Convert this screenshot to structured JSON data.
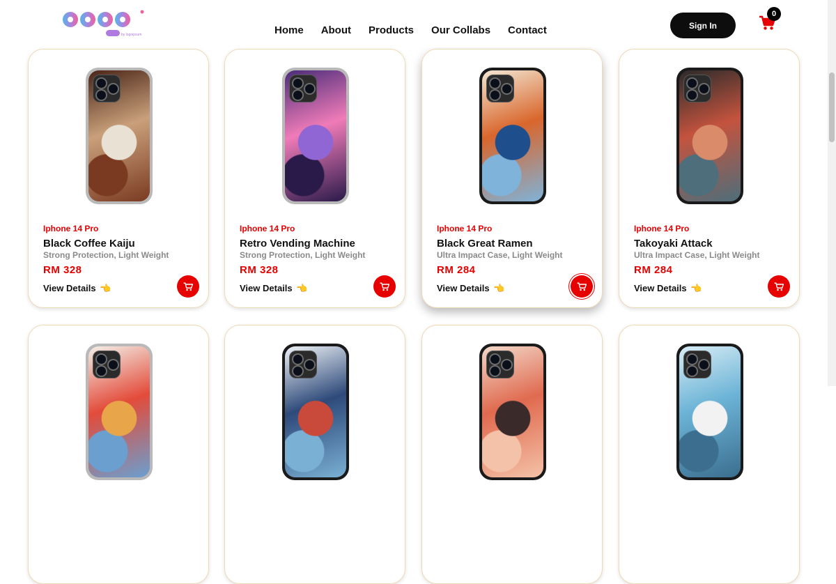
{
  "header": {
    "nav": [
      "Home",
      "About",
      "Products",
      "Our Collabs",
      "Contact"
    ],
    "signin_label": "Sign In",
    "cart_count": "0"
  },
  "products": [
    {
      "model": "Iphone 14 Pro",
      "name": "Black Coffee Kaiju",
      "desc": "Strong Protection, Light Weight",
      "price": "RM 328",
      "details": "View Details",
      "case": "clear",
      "colors": [
        "#4a2418",
        "#c9a07a",
        "#e9e2d4",
        "#7a3a22"
      ]
    },
    {
      "model": "Iphone 14 Pro",
      "name": "Retro Vending Machine",
      "desc": "Strong Protection, Light Weight",
      "price": "RM 328",
      "details": "View Details",
      "case": "clear",
      "colors": [
        "#4a2d7a",
        "#f07bb8",
        "#8f66d4",
        "#2a1a4a"
      ]
    },
    {
      "model": "Iphone 14 Pro",
      "name": "Black Great Ramen",
      "desc": "Ultra Impact Case, Light Weight",
      "price": "RM 284",
      "details": "View Details",
      "case": "black",
      "colors": [
        "#f2e7d3",
        "#d9662c",
        "#1e4f8c",
        "#7fb3d9"
      ]
    },
    {
      "model": "Iphone 14 Pro",
      "name": "Takoyaki Attack",
      "desc": "Ultra Impact Case, Light Weight",
      "price": "RM 284",
      "details": "View Details",
      "case": "black",
      "colors": [
        "#2b2b2b",
        "#c4533e",
        "#d98b6a",
        "#4d6e7a"
      ]
    }
  ],
  "second_row": [
    {
      "case": "clear",
      "colors": [
        "#f3f0e8",
        "#e34b3a",
        "#e9a54a",
        "#6a9fd0"
      ]
    },
    {
      "case": "black",
      "colors": [
        "#eef2f6",
        "#2e4a7a",
        "#c94a3a",
        "#7ab0d4"
      ]
    },
    {
      "case": "black",
      "colors": [
        "#f2d8c9",
        "#e06a4f",
        "#3b2a2a",
        "#f4c2a8"
      ]
    },
    {
      "case": "black",
      "colors": [
        "#d7ecf5",
        "#6bb3d6",
        "#f2f2f2",
        "#3b6e8f"
      ]
    }
  ],
  "colors": {
    "accent": "#e60000",
    "border": "#f0d9b5",
    "dark": "#0d0d0d"
  }
}
